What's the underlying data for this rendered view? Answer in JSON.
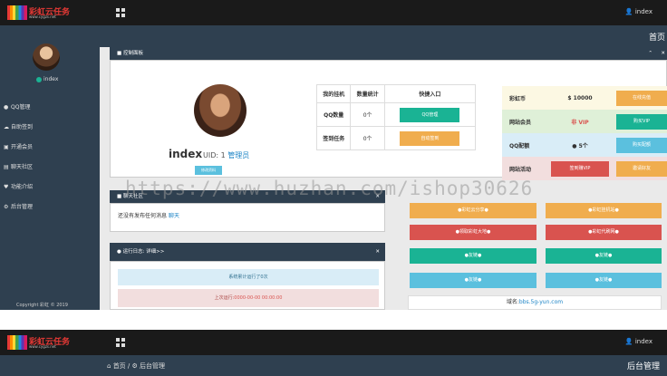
{
  "app": {
    "logo_text": "彩虹云任务",
    "logo_sub": "www.cygzs.net",
    "user": "index",
    "home_label": "首页"
  },
  "sidebar": {
    "username": "index",
    "items": [
      {
        "icon": "globe-icon",
        "label": "QQ管理"
      },
      {
        "icon": "cloud-icon",
        "label": "自助签到"
      },
      {
        "icon": "cart-icon",
        "label": "开通会员"
      },
      {
        "icon": "chart-icon",
        "label": "聊天社区"
      },
      {
        "icon": "heart-icon",
        "label": "功能介绍"
      },
      {
        "icon": "gear-icon",
        "label": "后台管理"
      }
    ],
    "copyright": "Copyright 彩虹 © 2019"
  },
  "control_panel": {
    "title": "控制面板",
    "profile": {
      "name": "index",
      "uid_label": "UID:",
      "uid": "1",
      "role": "管理员",
      "action": "修改资料"
    },
    "table": {
      "headers": [
        "我的挂机",
        "数量统计",
        "快捷入口"
      ],
      "rows": [
        {
          "label": "QQ数量",
          "count": "0个",
          "button": "QQ管理",
          "color": "#1ab394"
        },
        {
          "label": "签到任务",
          "count": "0个",
          "button": "自动签到",
          "color": "#f0ad4e"
        }
      ]
    },
    "wallet": [
      {
        "label": "彩虹币",
        "value": "$ 10000",
        "button": "在线充值",
        "bg": "#fcf8e3",
        "color": "#f0ad4e",
        "vcolor": "#333"
      },
      {
        "label": "网站会员",
        "value": "非 VIP",
        "button": "购买VIP",
        "bg": "#dff0d8",
        "color": "#1ab394",
        "vcolor": "#d9534f"
      },
      {
        "label": "QQ配额",
        "value": "5个",
        "button": "购买配额",
        "bg": "#d9edf7",
        "color": "#5bc0de",
        "vcolor": "#333"
      },
      {
        "label": "网站活动",
        "value": "签到赚VIP",
        "button": "邀请好友",
        "bg": "#f2dede",
        "color": "#f0ad4e",
        "vcolor": "#fff"
      }
    ]
  },
  "messages": {
    "title": "聊天社区",
    "text": "还没有发布任何消息",
    "link": "聊天"
  },
  "log": {
    "title": "运行日志:",
    "link": "详细>>",
    "status": "系统累计运行了0次",
    "last_run_label": "上次运行:",
    "last_run": "0000-00-00 00:00:00"
  },
  "quick_buttons": [
    {
      "label": "●彩虹云分享●",
      "color": "#f0ad4e"
    },
    {
      "label": "●彩虹挂机站●",
      "color": "#f0ad4e"
    },
    {
      "label": "●领取彩虹大地●",
      "color": "#d9534f"
    },
    {
      "label": "●彩虹代刷网●",
      "color": "#d9534f"
    },
    {
      "label": "●友链●",
      "color": "#1ab394"
    },
    {
      "label": "●友链●",
      "color": "#1ab394"
    },
    {
      "label": "●友链●",
      "color": "#5bc0de"
    },
    {
      "label": "●友链●",
      "color": "#5bc0de"
    }
  ],
  "domain": {
    "label": "域名:",
    "value": "bbs.5g-yun.com"
  },
  "watermark": "https://www.huzhan.com/ishop30626",
  "second_view": {
    "user": "index",
    "crumb_home": "首页",
    "crumb_current": "后台管理",
    "title": "后台管理"
  }
}
